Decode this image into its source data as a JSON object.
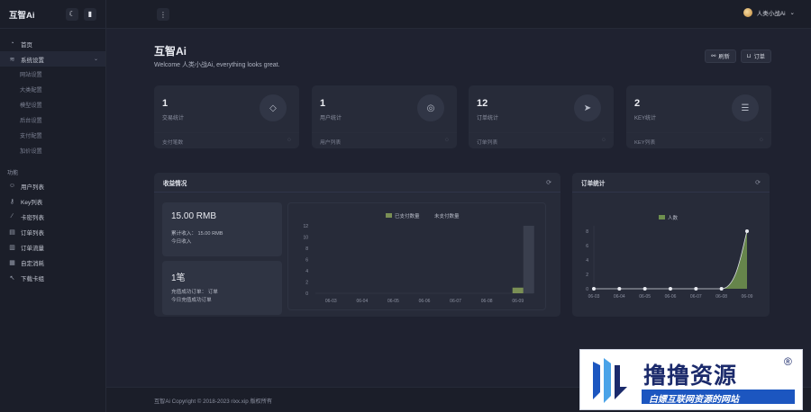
{
  "app": {
    "brand": "互智Ai"
  },
  "topbar": {
    "user_name": "人类小战Ai"
  },
  "sidebar": {
    "home": "首页",
    "system": "系统设置",
    "system_children": [
      "网站设置",
      "大类配置",
      "模型设置",
      "后台设置",
      "支付配置",
      "加价设置"
    ],
    "section_label": "功能",
    "items": [
      "用户列表",
      "Key列表",
      "卡密列表",
      "订单列表",
      "订单流量",
      "自定消耗",
      "下载卡组"
    ]
  },
  "header": {
    "title": "互智Ai",
    "welcome": "Welcome 人类小战Ai, everything looks great.",
    "btn_refresh": "刷新",
    "btn_orders": "订单"
  },
  "stats": [
    {
      "value": "1",
      "label": "交易统计",
      "footer": "支付笔数"
    },
    {
      "value": "1",
      "label": "用户统计",
      "footer": "用户列表"
    },
    {
      "value": "12",
      "label": "订单统计",
      "footer": "订单列表"
    },
    {
      "value": "2",
      "label": "KEY统计",
      "footer": "KEY列表"
    }
  ],
  "sales_panel": {
    "title": "收益情况",
    "card1": {
      "amount": "15.00 RMB",
      "line1": "累计收入： 15.00 RMB",
      "line2": "今日收入"
    },
    "card2": {
      "amount": "1笔",
      "line1": "充值成功订单： 订单",
      "line2": "今日充值成功订单"
    }
  },
  "order_panel": {
    "title": "订单统计"
  },
  "chart_data": [
    {
      "type": "bar",
      "title": "",
      "legend": [
        "已支付数量",
        "未支付数量"
      ],
      "legend_position": "top",
      "categories": [
        "06-03",
        "06-04",
        "06-05",
        "06-06",
        "06-07",
        "06-08",
        "06-09"
      ],
      "series": [
        {
          "name": "已支付数量",
          "values": [
            0,
            0,
            0,
            0,
            0,
            0,
            1
          ]
        },
        {
          "name": "未支付数量",
          "values": [
            0,
            0,
            0,
            0,
            0,
            0,
            12
          ]
        }
      ],
      "y_ticks": [
        "0",
        "2",
        "4",
        "6",
        "8",
        "10",
        "12"
      ],
      "ylim": [
        0,
        12
      ],
      "colors": {
        "paid": "#7a8f55",
        "unpaid": "#3a3f4e"
      }
    },
    {
      "type": "area",
      "title": "",
      "legend": [
        "人数"
      ],
      "legend_position": "top",
      "categories": [
        "06-03",
        "06-04",
        "06-05",
        "06-06",
        "06-07",
        "06-08",
        "06-09"
      ],
      "series": [
        {
          "name": "人数",
          "values": [
            0,
            0,
            0,
            0,
            0,
            0,
            8
          ]
        }
      ],
      "y_ticks": [
        "0",
        "2",
        "4",
        "6",
        "8"
      ],
      "ylim": [
        0,
        8
      ],
      "colors": {
        "fill": "#6e8f4e"
      }
    }
  ],
  "footer": {
    "text": "互智Ai Copyright © 2018-2023 rixx.xip 版权所有"
  },
  "watermark": {
    "title": "撸撸资源",
    "subtitle": "白嫖互联网资源的网站",
    "reg": "®"
  }
}
